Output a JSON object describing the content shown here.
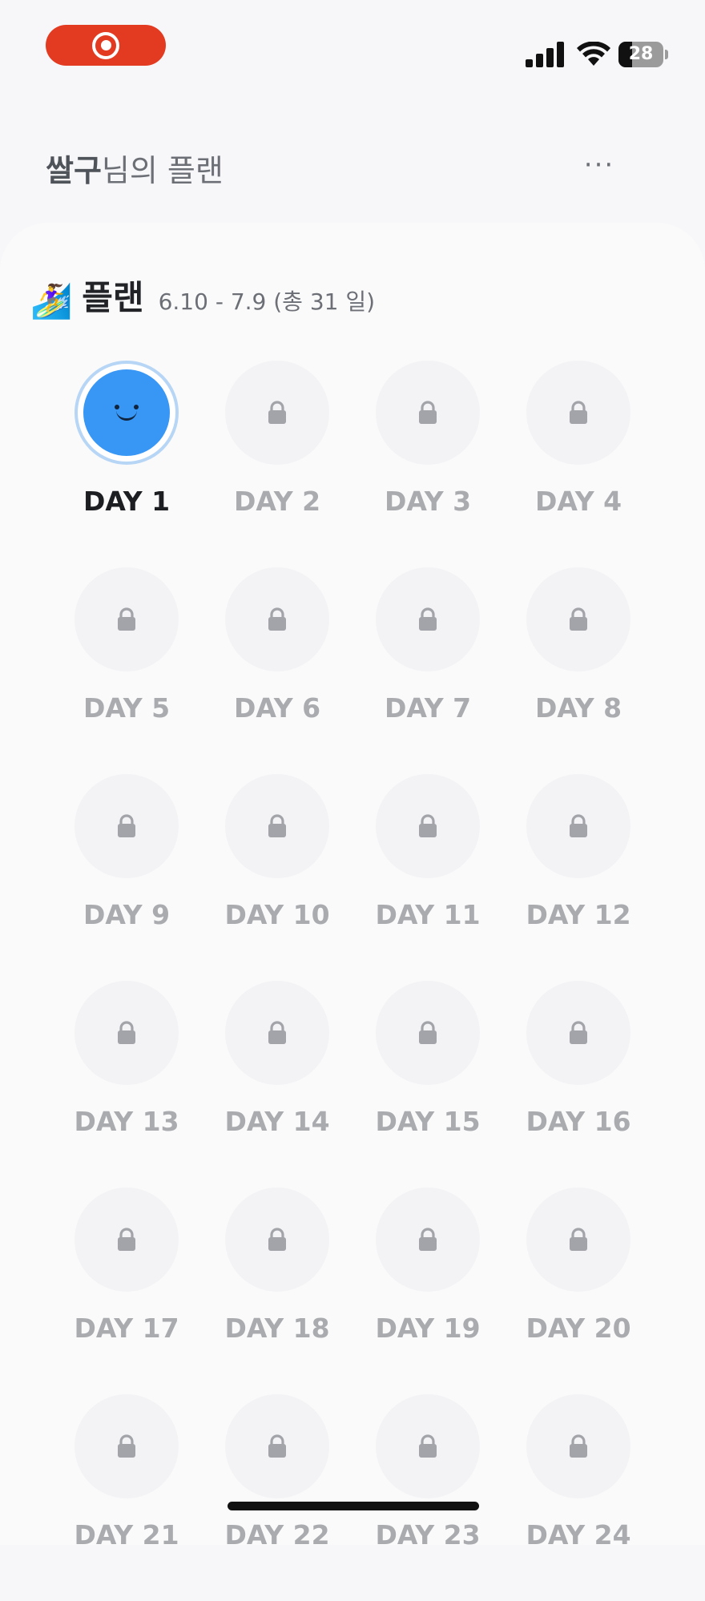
{
  "status_bar": {
    "battery_level": "28",
    "recording": true
  },
  "header": {
    "user_name": "쌀구",
    "title_suffix": "님의 플랜",
    "more_label": "···"
  },
  "plan": {
    "emoji": "🏄‍♀️",
    "title": "플랜",
    "range": "6.10 - 7.9 (총 31 일)"
  },
  "days": [
    {
      "label": "DAY 1",
      "state": "active"
    },
    {
      "label": "DAY 2",
      "state": "locked"
    },
    {
      "label": "DAY 3",
      "state": "locked"
    },
    {
      "label": "DAY 4",
      "state": "locked"
    },
    {
      "label": "DAY 5",
      "state": "locked"
    },
    {
      "label": "DAY 6",
      "state": "locked"
    },
    {
      "label": "DAY 7",
      "state": "locked"
    },
    {
      "label": "DAY 8",
      "state": "locked"
    },
    {
      "label": "DAY 9",
      "state": "locked"
    },
    {
      "label": "DAY 10",
      "state": "locked"
    },
    {
      "label": "DAY 11",
      "state": "locked"
    },
    {
      "label": "DAY 12",
      "state": "locked"
    },
    {
      "label": "DAY 13",
      "state": "locked"
    },
    {
      "label": "DAY 14",
      "state": "locked"
    },
    {
      "label": "DAY 15",
      "state": "locked"
    },
    {
      "label": "DAY 16",
      "state": "locked"
    },
    {
      "label": "DAY 17",
      "state": "locked"
    },
    {
      "label": "DAY 18",
      "state": "locked"
    },
    {
      "label": "DAY 19",
      "state": "locked"
    },
    {
      "label": "DAY 20",
      "state": "locked"
    },
    {
      "label": "DAY 21",
      "state": "locked"
    },
    {
      "label": "DAY 22",
      "state": "locked"
    },
    {
      "label": "DAY 23",
      "state": "locked"
    },
    {
      "label": "DAY 24",
      "state": "locked"
    }
  ],
  "colors": {
    "active_face": "#3897f5",
    "record_pill": "#e23b22",
    "locked_label": "#a9abaf",
    "active_label": "#1d1e21"
  },
  "icons": {
    "record": "record-icon",
    "signal": "cellular-signal-icon",
    "wifi": "wifi-icon",
    "battery": "battery-icon",
    "more": "more-dots-icon",
    "lock": "lock-icon",
    "face": "smiley-face-icon"
  }
}
